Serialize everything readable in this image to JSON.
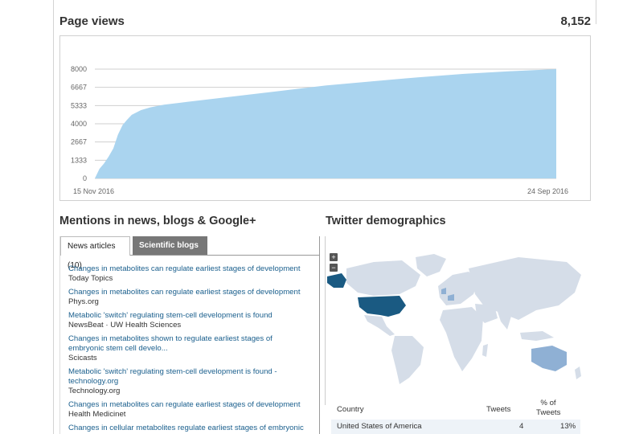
{
  "page_views": {
    "title": "Page views",
    "total": "8,152",
    "chart_data": {
      "type": "area",
      "y_ticks": [
        "8000",
        "6667",
        "5333",
        "4000",
        "2667",
        "1333",
        "0"
      ],
      "ylim": [
        0,
        8000
      ],
      "x_start_label": "15 Nov 2016",
      "x_end_label": "24 Sep 2016",
      "grid": true,
      "color": "#aad4ef",
      "x": [
        0,
        0.01,
        0.02,
        0.03,
        0.04,
        0.05,
        0.06,
        0.07,
        0.08,
        0.1,
        0.12,
        0.15,
        0.2,
        0.25,
        0.3,
        0.4,
        0.5,
        0.6,
        0.7,
        0.8,
        0.9,
        1.0
      ],
      "values": [
        0,
        700,
        1100,
        1600,
        2200,
        3200,
        3900,
        4300,
        4650,
        5000,
        5200,
        5400,
        5600,
        5800,
        6000,
        6400,
        6800,
        7100,
        7400,
        7650,
        7850,
        8152
      ]
    }
  },
  "mentions": {
    "title": "Mentions in news, blogs & Google+",
    "tabs": [
      {
        "label": "News articles (10)",
        "active": true
      },
      {
        "label": "Scientific blogs (1)",
        "active": false
      }
    ],
    "items": [
      {
        "title": "Changes in metabolites can regulate earliest stages of development",
        "source": "Today Topics"
      },
      {
        "title": "Changes in metabolites can regulate earliest stages of development",
        "source": "Phys.org"
      },
      {
        "title": "Metabolic 'switch' regulating stem-cell development is found",
        "source": "NewsBeat · UW Health Sciences"
      },
      {
        "title": "Changes in metabolites shown to regulate earliest stages of embryonic stem cell develo...",
        "source": "Scicasts"
      },
      {
        "title": "Metabolic 'switch' regulating stem-cell development is found - technology.org",
        "source": "Technology.org"
      },
      {
        "title": "Changes in metabolites can regulate earliest stages of development",
        "source": "Health Medicinet"
      },
      {
        "title": "Changes in cellular metabolites regulate earliest stages of embryonic",
        "source": ""
      }
    ]
  },
  "twitter": {
    "title": "Twitter demographics",
    "zoom_in": "+",
    "zoom_out": "−",
    "map_colors": {
      "land": "#d5dde8",
      "highlight_strong": "#1a5a82",
      "highlight_light": "#8fb0d4"
    },
    "table": {
      "headers": {
        "country": "Country",
        "tweets": "Tweets",
        "pct": "% of Tweets"
      },
      "rows": [
        {
          "country": "United States of America",
          "tweets": "4",
          "pct": "13%"
        }
      ]
    }
  }
}
